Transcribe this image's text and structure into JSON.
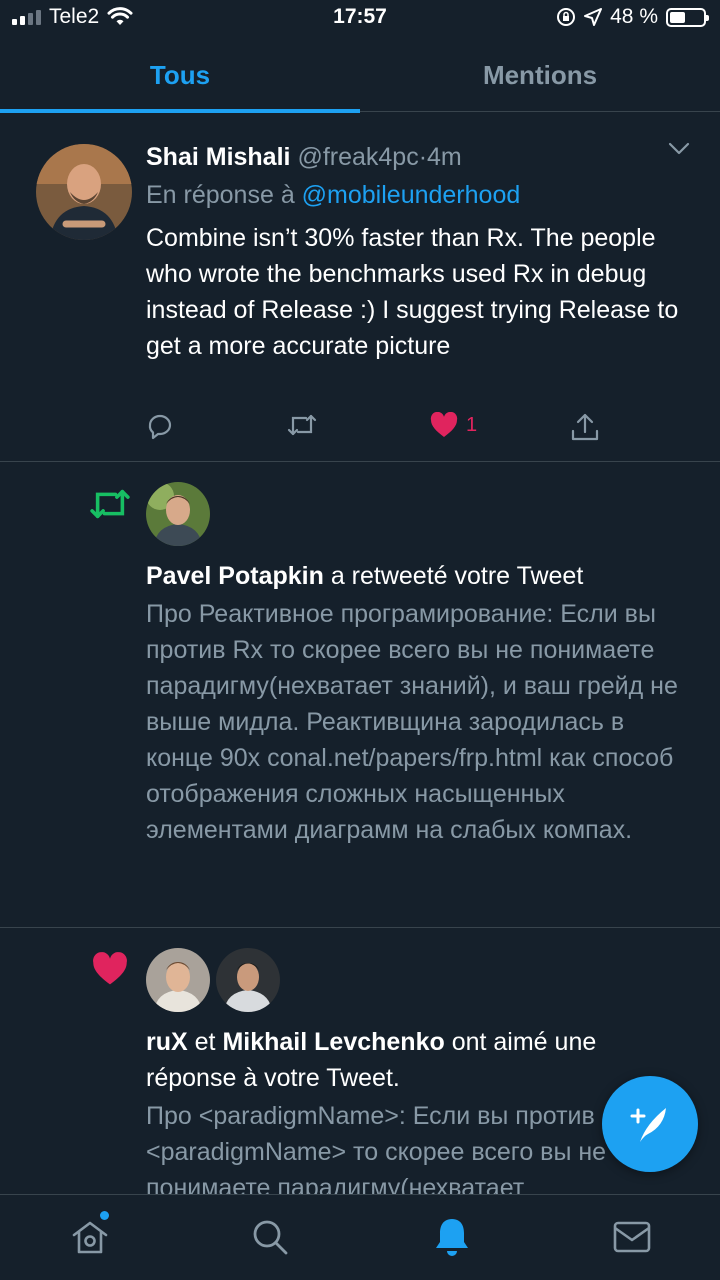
{
  "status_bar": {
    "carrier": "Tele2",
    "time": "17:57",
    "battery": "48 %",
    "battery_level": 0.48
  },
  "tabs": [
    {
      "label": "Tous",
      "active": true
    },
    {
      "label": "Mentions",
      "active": false
    }
  ],
  "tweet": {
    "name": "Shai Mishali",
    "handle": "@freak4pc",
    "sep": "·",
    "time": "4m",
    "reply_prefix": "En réponse à",
    "reply_handle": "@mobileunderhood",
    "text": "Combine isn’t 30% faster than Rx. The people who wrote the benchmarks used Rx in debug instead of Release :) I suggest trying Release to get a more accurate picture",
    "like_count": "1",
    "icons": [
      "reply-icon",
      "retweet-icon",
      "like-icon",
      "share-icon",
      "chevron-down-icon"
    ]
  },
  "retweet_notification": {
    "icon": "retweet-icon",
    "user": "Pavel Potapkin",
    "action": "a retweeté votre Tweet",
    "text": "Про Реактивное програмирование: Если вы против Rx то скорее всего вы не понимаете парадигму(нехватает знаний), и ваш грейд не выше мидла. Реактивщина зародилась в конце 90х conal.net/papers/frp.html как способ отображения сложных насыщенных элементами диаграмм на слабых компах."
  },
  "like_notification": {
    "icon": "heart-icon",
    "user1": "ruX",
    "conj": "et",
    "user2": "Mikhail Levchenko",
    "action": "ont aimé une réponse à votre Tweet.",
    "text": "Про <paradigmName>: Если вы против <paradigmName> то скорее всего вы не понимаете парадигму(нехватает"
  },
  "colors": {
    "background": "#15202b",
    "accent": "#1da1f2",
    "muted": "#8899a6",
    "like": "#e0245e",
    "retweet": "#17bf63",
    "divider": "#38444d"
  },
  "bottom_nav": [
    {
      "icon": "home-icon",
      "active": false,
      "badge": true
    },
    {
      "icon": "search-icon",
      "active": false
    },
    {
      "icon": "notifications-icon",
      "active": true
    },
    {
      "icon": "messages-icon",
      "active": false
    }
  ],
  "fab": {
    "icon": "compose-tweet-icon"
  }
}
